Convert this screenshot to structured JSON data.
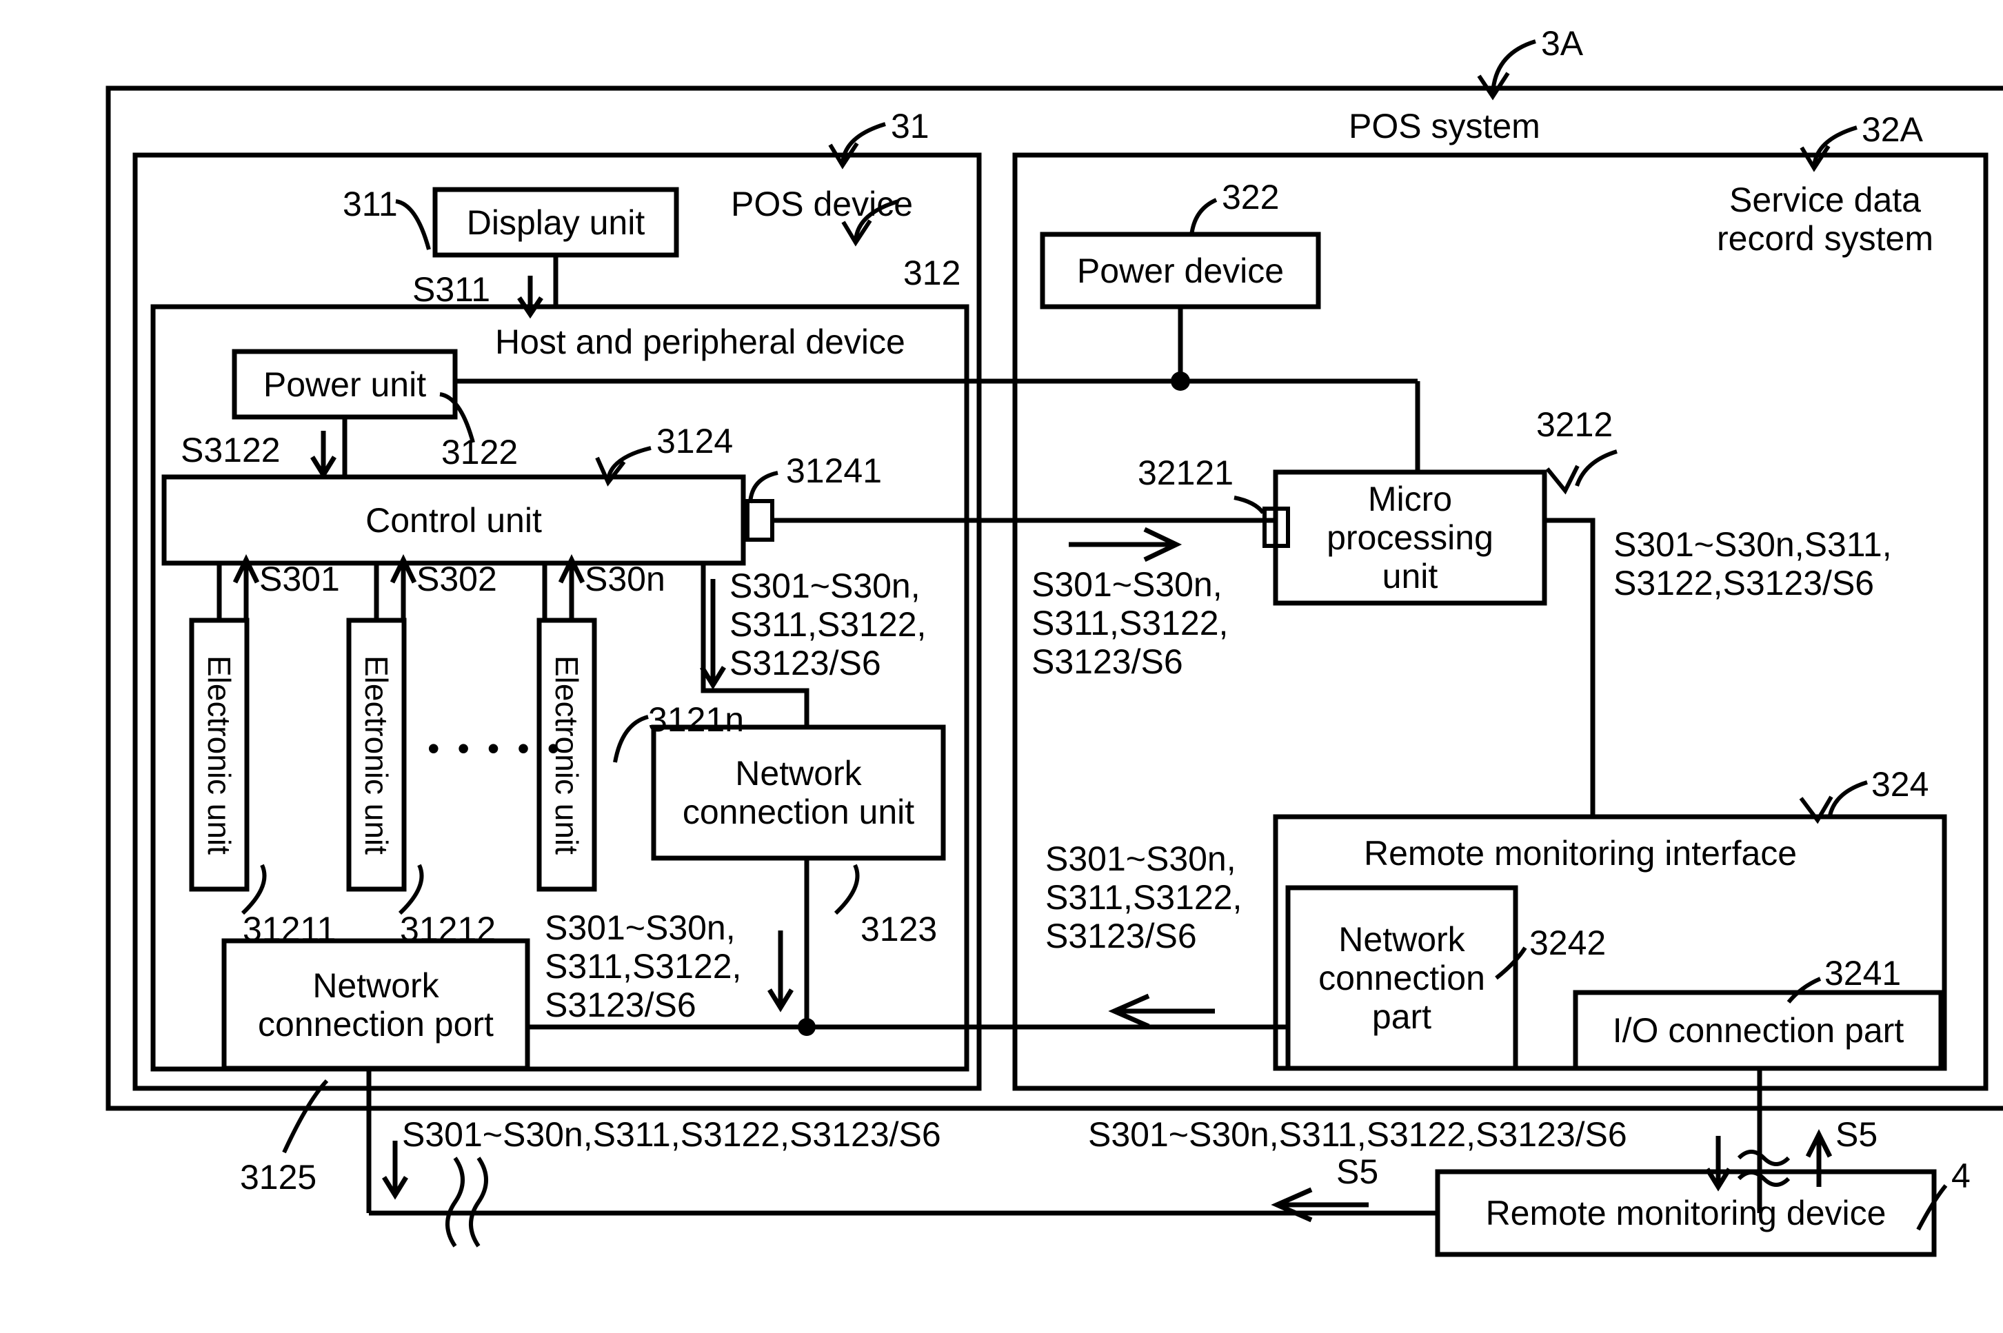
{
  "figure": {
    "system_label": "POS system",
    "system_ref": "3A",
    "pos_device_label": "POS device",
    "pos_device_ref": "31",
    "service_system_label": "Service data\nrecord system",
    "service_system_ref": "32A"
  },
  "pos_device": {
    "display_unit": {
      "label": "Display unit",
      "ref": "311"
    },
    "signal_display": "S311",
    "host_peripheral": {
      "label": "Host and peripheral device",
      "ref": "312"
    },
    "power_unit": {
      "label": "Power unit",
      "ref": "3122"
    },
    "signal_power": "S3122",
    "control_unit": {
      "label": "Control unit",
      "ref": "3124"
    },
    "control_port_ref": "31241",
    "electronic_units": [
      {
        "label": "Electronic unit",
        "ref": "31211",
        "signal": "S301"
      },
      {
        "label": "Electronic unit",
        "ref": "31212",
        "signal": "S302"
      },
      {
        "label": "Electronic unit",
        "ref": "3121n",
        "signal": "S30n"
      }
    ],
    "ellipsis": "• • • • •",
    "network_connection_unit": {
      "label": "Network\nconnection unit",
      "ref": "3123"
    },
    "network_connection_port": {
      "label": "Network\nconnection port",
      "ref": "3125"
    },
    "signal_bundle_control_to_ncu": "S301~S30n,\nS311,S3122,\nS3123/S6",
    "signal_bundle_ncu_to_port": "S301~S30n,\nS311,S3122,\nS3123/S6"
  },
  "service_system": {
    "power_device": {
      "label": "Power device",
      "ref": "322"
    },
    "micro_processing_unit": {
      "label": "Micro\nprocessing\nunit",
      "ref": "3212"
    },
    "micro_port_ref": "32121",
    "signal_in_mpu": "S301~S30n,\nS311,S3122,\nS3123/S6",
    "signal_out_mpu": "S301~S30n,S311,\nS3122,S3123/S6",
    "remote_monitoring_interface": {
      "label": "Remote monitoring interface",
      "ref": "324"
    },
    "network_connection_part": {
      "label": "Network\nconnection\npart",
      "ref": "3242"
    },
    "io_connection_part": {
      "label": "I/O connection part",
      "ref": "3241"
    },
    "signal_to_ncp": "S301~S30n,\nS311,S3122,\nS3123/S6"
  },
  "bottom": {
    "left_signal_bundle": "S301~S30n,S311,S3122,S3123/S6",
    "right_signal_bundle": "S301~S30n,S311,S3122,S3123/S6",
    "s5_up": "S5",
    "s5_left": "S5",
    "remote_monitoring_device": {
      "label": "Remote monitoring device",
      "ref": "4"
    }
  },
  "colors": {
    "stroke": "#000000",
    "background": "#ffffff"
  }
}
